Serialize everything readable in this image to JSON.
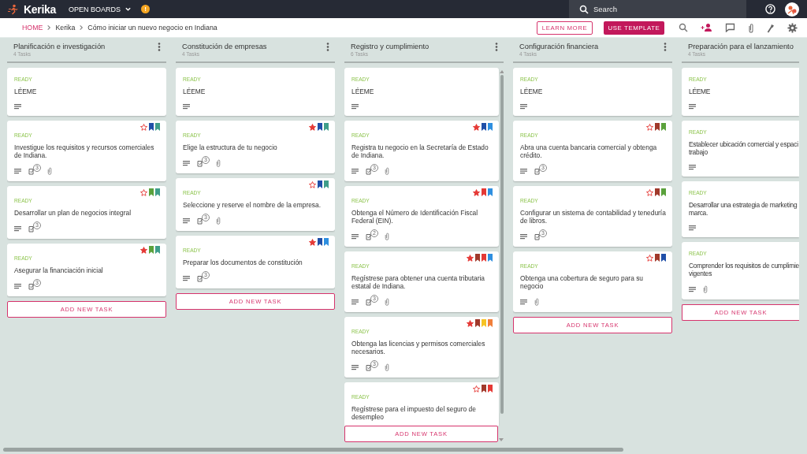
{
  "top_bar": {
    "logo": "Kerika",
    "boards_menu": "OPEN BOARDS",
    "alert_badge": "!",
    "search": {
      "placeholder": "Search"
    }
  },
  "breadcrumb": [
    "HOME",
    "Kerika",
    "Cómo iniciar un nuevo negocio en Indiana"
  ],
  "actions": {
    "learn_more": "LEARN MORE",
    "use_template": "USE TEMPLATE"
  },
  "columns": [
    {
      "title": "Planificación e investigación",
      "count": "4 Tasks",
      "clipped": false,
      "add_button": "ADD NEW TASK",
      "cards": [
        {
          "status": "READY",
          "title": "LÉEME",
          "icons": [
            {
              "kind": "description"
            }
          ]
        },
        {
          "status": "READY",
          "title": "Investigue los requisitos y recursos comerciales de Indiana.",
          "starred": false,
          "tags": [
            {
              "color": "#1f4fa8"
            },
            {
              "color": "#3f9e8a"
            }
          ],
          "icons": [
            {
              "kind": "description"
            },
            {
              "kind": "checklist",
              "count": "3"
            },
            {
              "kind": "attachment"
            }
          ]
        },
        {
          "status": "READY",
          "title": "Desarrollar un plan de negocios integral",
          "starred": false,
          "tags": [
            {
              "color": "#5aa13b"
            },
            {
              "color": "#3f9e8a"
            }
          ],
          "icons": [
            {
              "kind": "description"
            },
            {
              "kind": "checklist",
              "count": "3"
            }
          ]
        },
        {
          "status": "READY",
          "title": "Asegurar la financiación inicial",
          "starred": true,
          "tags": [
            {
              "color": "#5aa13b"
            },
            {
              "color": "#3f9e8a"
            }
          ],
          "icons": [
            {
              "kind": "description"
            },
            {
              "kind": "checklist",
              "count": "3"
            }
          ]
        }
      ]
    },
    {
      "title": "Constitución de empresas",
      "count": "4 Tasks",
      "clipped": false,
      "add_button": "ADD NEW TASK",
      "cards": [
        {
          "status": "READY",
          "title": "LÉEME",
          "icons": [
            {
              "kind": "description"
            }
          ]
        },
        {
          "status": "READY",
          "title": "Elige la estructura de tu negocio",
          "starred": true,
          "tags": [
            {
              "color": "#1f4fa8"
            },
            {
              "color": "#3f9e8a"
            }
          ],
          "icons": [
            {
              "kind": "description"
            },
            {
              "kind": "checklist",
              "count": "3"
            },
            {
              "kind": "attachment"
            }
          ]
        },
        {
          "status": "READY",
          "title": "Seleccione y reserve el nombre de la empresa.",
          "starred": false,
          "tags": [
            {
              "color": "#1f4fa8"
            },
            {
              "color": "#3f9e8a"
            }
          ],
          "icons": [
            {
              "kind": "description"
            },
            {
              "kind": "checklist",
              "count": "3"
            },
            {
              "kind": "attachment"
            }
          ]
        },
        {
          "status": "READY",
          "title": "Preparar los documentos de constitución",
          "starred": true,
          "tags": [
            {
              "color": "#1f4fa8"
            },
            {
              "color": "#2e8fe0"
            }
          ],
          "icons": [
            {
              "kind": "description"
            },
            {
              "kind": "checklist",
              "count": "3"
            }
          ]
        }
      ]
    },
    {
      "title": "Registro y cumplimiento",
      "count": "6 Tasks",
      "clipped": false,
      "add_button": "ADD NEW TASK",
      "cards": [
        {
          "status": "READY",
          "title": "LÉEME",
          "icons": [
            {
              "kind": "description"
            }
          ]
        },
        {
          "status": "READY",
          "title": "Registra tu negocio en la Secretaría de Estado de Indiana.",
          "starred": true,
          "tags": [
            {
              "color": "#1f4fa8"
            },
            {
              "color": "#2e8fe0"
            }
          ],
          "icons": [
            {
              "kind": "description"
            },
            {
              "kind": "checklist",
              "count": "3"
            },
            {
              "kind": "attachment"
            }
          ]
        },
        {
          "status": "READY",
          "title": "Obtenga el Número de Identificación Fiscal Federal (EIN).",
          "starred": true,
          "tags": [
            {
              "color": "#e53935"
            },
            {
              "color": "#2e8fe0"
            }
          ],
          "icons": [
            {
              "kind": "description"
            },
            {
              "kind": "checklist",
              "count": "2"
            },
            {
              "kind": "attachment"
            }
          ]
        },
        {
          "status": "READY",
          "title": "Regístrese para obtener una cuenta tributaria estatal de Indiana.",
          "starred": true,
          "tags": [
            {
              "color": "#a0392b"
            },
            {
              "color": "#e53935"
            },
            {
              "color": "#2e8fe0"
            }
          ],
          "icons": [
            {
              "kind": "description"
            },
            {
              "kind": "checklist",
              "count": "3"
            },
            {
              "kind": "attachment"
            }
          ]
        },
        {
          "status": "READY",
          "title": "Obtenga las licencias y permisos comerciales necesarios.",
          "starred": true,
          "tags": [
            {
              "color": "#a0392b"
            },
            {
              "color": "#f6c324"
            },
            {
              "color": "#f07f3a"
            }
          ],
          "icons": [
            {
              "kind": "description"
            },
            {
              "kind": "checklist",
              "count": "3"
            },
            {
              "kind": "attachment"
            }
          ]
        },
        {
          "status": "READY",
          "title": "Regístrese para el impuesto del seguro de desempleo",
          "starred": false,
          "tags": [
            {
              "color": "#a0392b"
            },
            {
              "color": "#e53935"
            }
          ]
        }
      ]
    },
    {
      "title": "Configuración financiera",
      "count": "4 Tasks",
      "clipped": false,
      "add_button": "ADD NEW TASK",
      "cards": [
        {
          "status": "READY",
          "title": "LÉEME",
          "icons": [
            {
              "kind": "description"
            }
          ]
        },
        {
          "status": "READY",
          "title": "Abra una cuenta bancaria comercial y obtenga crédito.",
          "starred": false,
          "tags": [
            {
              "color": "#a0392b"
            },
            {
              "color": "#5aa13b"
            }
          ],
          "icons": [
            {
              "kind": "description"
            },
            {
              "kind": "checklist",
              "count": "3"
            }
          ]
        },
        {
          "status": "READY",
          "title": "Configurar un sistema de contabilidad y teneduría de libros.",
          "starred": false,
          "tags": [
            {
              "color": "#a0392b"
            },
            {
              "color": "#5aa13b"
            }
          ],
          "icons": [
            {
              "kind": "description"
            },
            {
              "kind": "checklist",
              "count": "3"
            }
          ]
        },
        {
          "status": "READY",
          "title": "Obtenga una cobertura de seguro para su negocio",
          "starred": false,
          "tags": [
            {
              "color": "#a0392b"
            },
            {
              "color": "#1f4fa8"
            }
          ],
          "icons": [
            {
              "kind": "description"
            },
            {
              "kind": "attachment"
            }
          ]
        }
      ]
    },
    {
      "title": "Preparación para el lanzamiento",
      "count": "4 Tasks",
      "clipped": true,
      "add_button": "ADD NEW TASK",
      "cards": [
        {
          "status": "READY",
          "title": "LÉEME",
          "icons": [
            {
              "kind": "description"
            }
          ]
        },
        {
          "status": "READY",
          "title": "Establecer ubicación comercial y espaci\ntrabajo",
          "icons": [
            {
              "kind": "description"
            }
          ]
        },
        {
          "status": "READY",
          "title": "Desarrollar una estrategia de marketing\nmarca.",
          "icons": [
            {
              "kind": "description"
            }
          ]
        },
        {
          "status": "READY",
          "title": "Comprender los requisitos de cumplimie\nvigentes",
          "icons": [
            {
              "kind": "description"
            },
            {
              "kind": "attachment"
            }
          ]
        }
      ]
    }
  ]
}
